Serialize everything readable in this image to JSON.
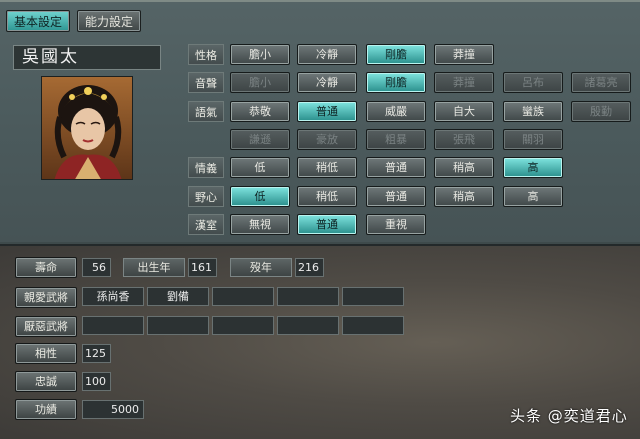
{
  "tabs": [
    {
      "label": "基本設定",
      "active": true
    },
    {
      "label": "能力設定",
      "active": false
    }
  ],
  "character_name": "吳國太",
  "traits": {
    "personality": {
      "label": "性格",
      "options": [
        "膽小",
        "冷靜",
        "剛膽",
        "莽撞"
      ],
      "selected": "剛膽"
    },
    "voice": {
      "label": "音聲",
      "options": [
        "膽小",
        "冷靜",
        "剛膽",
        "莽撞",
        "呂布",
        "諸葛亮"
      ],
      "selected": "剛膽"
    },
    "tone": {
      "label": "語氣",
      "options": [
        "恭敬",
        "普通",
        "威嚴",
        "自大",
        "蠻族",
        "殷勤"
      ],
      "options2": [
        "謙遜",
        "豪放",
        "粗暴",
        "張飛",
        "關羽"
      ],
      "selected": "普通"
    },
    "loyalty": {
      "label": "情義",
      "options": [
        "低",
        "稍低",
        "普通",
        "稍高",
        "高"
      ],
      "selected": "高"
    },
    "ambition": {
      "label": "野心",
      "options": [
        "低",
        "稍低",
        "普通",
        "稍高",
        "高"
      ],
      "selected": "低"
    },
    "han": {
      "label": "漢室",
      "options": [
        "無視",
        "普通",
        "重視"
      ],
      "selected": "普通"
    }
  },
  "stats": {
    "lifespan_label": "壽命",
    "lifespan": "56",
    "birth_label": "出生年",
    "birth": "161",
    "death_label": "歿年",
    "death": "216",
    "affinity_label": "相性",
    "affinity": "125",
    "loyalty_label": "忠誠",
    "loyalty": "100",
    "merit_label": "功績",
    "merit": "5000"
  },
  "relations": {
    "liked_label": "親愛武將",
    "liked": [
      "孫尚香",
      "劉備",
      "",
      "",
      ""
    ],
    "disliked_label": "厭惡武將",
    "disliked": [
      "",
      "",
      "",
      "",
      ""
    ]
  },
  "watermark": "头条 @奕道君心",
  "colors": {
    "accent": "#4ec3bf",
    "panel": "#4b5a5c"
  }
}
